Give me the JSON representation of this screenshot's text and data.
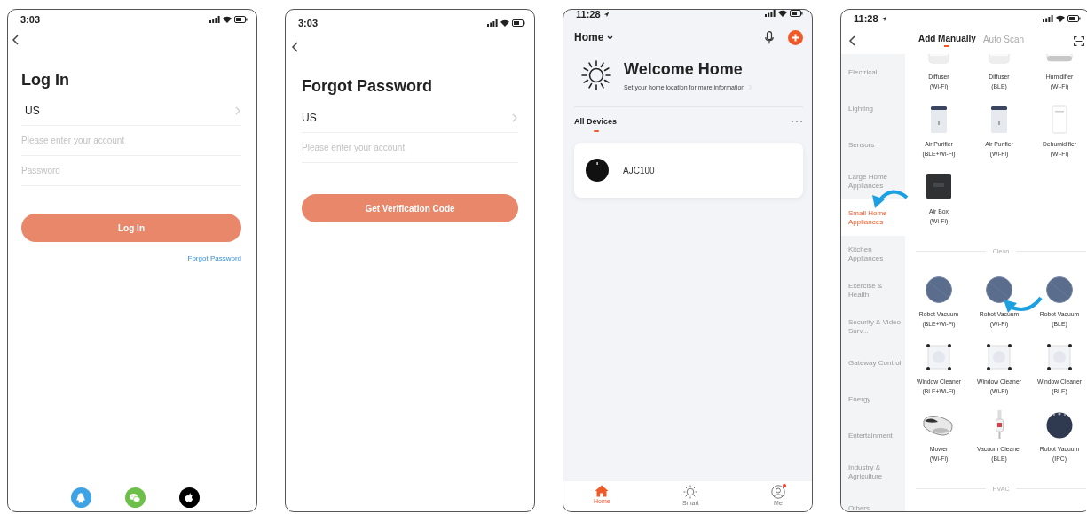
{
  "screens": [
    {
      "kind": "login",
      "status_time": "3:03",
      "title": "Log In",
      "region": "US",
      "fields": [
        {
          "placeholder": "Please enter your account"
        },
        {
          "placeholder": "Password"
        }
      ],
      "button": {
        "label": "Log In",
        "disabled": true
      },
      "link": "Forgot Password",
      "social_logins": [
        {
          "kind": "qq"
        },
        {
          "kind": "wechat"
        },
        {
          "kind": "apple"
        }
      ]
    },
    {
      "kind": "forgot_password",
      "status_time": "3:03",
      "title": "Forgot Password",
      "region": "US",
      "fields": [
        {
          "placeholder": "Please enter your account"
        }
      ],
      "button": {
        "label": "Get Verification Code",
        "disabled": true
      }
    },
    {
      "kind": "home",
      "status_time": "11:28",
      "location_arrow": true,
      "home_menu": "Home",
      "welcome": {
        "title": "Welcome Home",
        "subtitle": "Set your home location for more information"
      },
      "section": "All Devices",
      "devices": [
        {
          "name": "AJC100"
        }
      ],
      "tabs": [
        {
          "label": "Home",
          "selected": true
        },
        {
          "label": "Smart",
          "selected": false
        },
        {
          "label": "Me",
          "selected": false,
          "notification": true
        }
      ]
    },
    {
      "kind": "add_device",
      "status_time": "11:28",
      "location_arrow": true,
      "tabs": [
        {
          "label": "Add Manually",
          "selected": true
        },
        {
          "label": "Auto Scan",
          "selected": false
        }
      ],
      "categories": [
        {
          "label": "Electrical",
          "selected": false
        },
        {
          "label": "Lighting",
          "selected": false
        },
        {
          "label": "Sensors",
          "selected": false
        },
        {
          "label": "Large Home Appliances",
          "selected": false
        },
        {
          "label": "Small Home Appliances",
          "selected": true
        },
        {
          "label": "Kitchen Appliances",
          "selected": false
        },
        {
          "label": "Exercise & Health",
          "selected": false
        },
        {
          "label": "Security & Video Surv...",
          "selected": false
        },
        {
          "label": "Gateway Control",
          "selected": false
        },
        {
          "label": "Energy",
          "selected": false
        },
        {
          "label": "Entertainment",
          "selected": false
        },
        {
          "label": "Industry & Agriculture",
          "selected": false
        },
        {
          "label": "Others",
          "selected": false
        }
      ],
      "blocks": [
        {
          "kind": "devices",
          "items": [
            {
              "kind": "diffuser",
              "name": "Diffuser",
              "connection": "(Wi-Fi)"
            },
            {
              "kind": "diffuser",
              "name": "Diffuser",
              "connection": "(BLE)"
            },
            {
              "kind": "humidifier",
              "name": "Humidifier",
              "connection": "(Wi-Fi)"
            },
            {
              "kind": "purifier",
              "name": "Air Purifier",
              "connection": "(BLE+Wi-Fi)"
            },
            {
              "kind": "purifier",
              "name": "Air Purifier",
              "connection": "(Wi-Fi)"
            },
            {
              "kind": "dehumidifier",
              "name": "Dehumidifier",
              "connection": "(Wi-Fi)"
            },
            {
              "kind": "air_box",
              "name": "Air Box",
              "connection": "(Wi-Fi)"
            }
          ]
        },
        {
          "kind": "divider",
          "title": "Clean"
        },
        {
          "kind": "devices",
          "items": [
            {
              "kind": "robot",
              "name": "Robot Vacuum",
              "connection": "(BLE+Wi-Fi)"
            },
            {
              "kind": "robot",
              "name": "Robot Vacuum",
              "connection": "(Wi-Fi)"
            },
            {
              "kind": "robot",
              "name": "Robot Vacuum",
              "connection": "(BLE)"
            },
            {
              "kind": "window",
              "name": "Window Cleaner",
              "connection": "(BLE+Wi-Fi)"
            },
            {
              "kind": "window",
              "name": "Window Cleaner",
              "connection": "(Wi-Fi)"
            },
            {
              "kind": "window",
              "name": "Window Cleaner",
              "connection": "(BLE)"
            },
            {
              "kind": "mower",
              "name": "Mower",
              "connection": "(Wi-Fi)"
            },
            {
              "kind": "stick",
              "name": "Vacuum Cleaner",
              "connection": "(BLE)"
            },
            {
              "kind": "robot_cam",
              "name": "Robot Vacuum",
              "connection": "(IPC)"
            }
          ]
        },
        {
          "kind": "divider",
          "title": "HVAC"
        }
      ]
    }
  ]
}
